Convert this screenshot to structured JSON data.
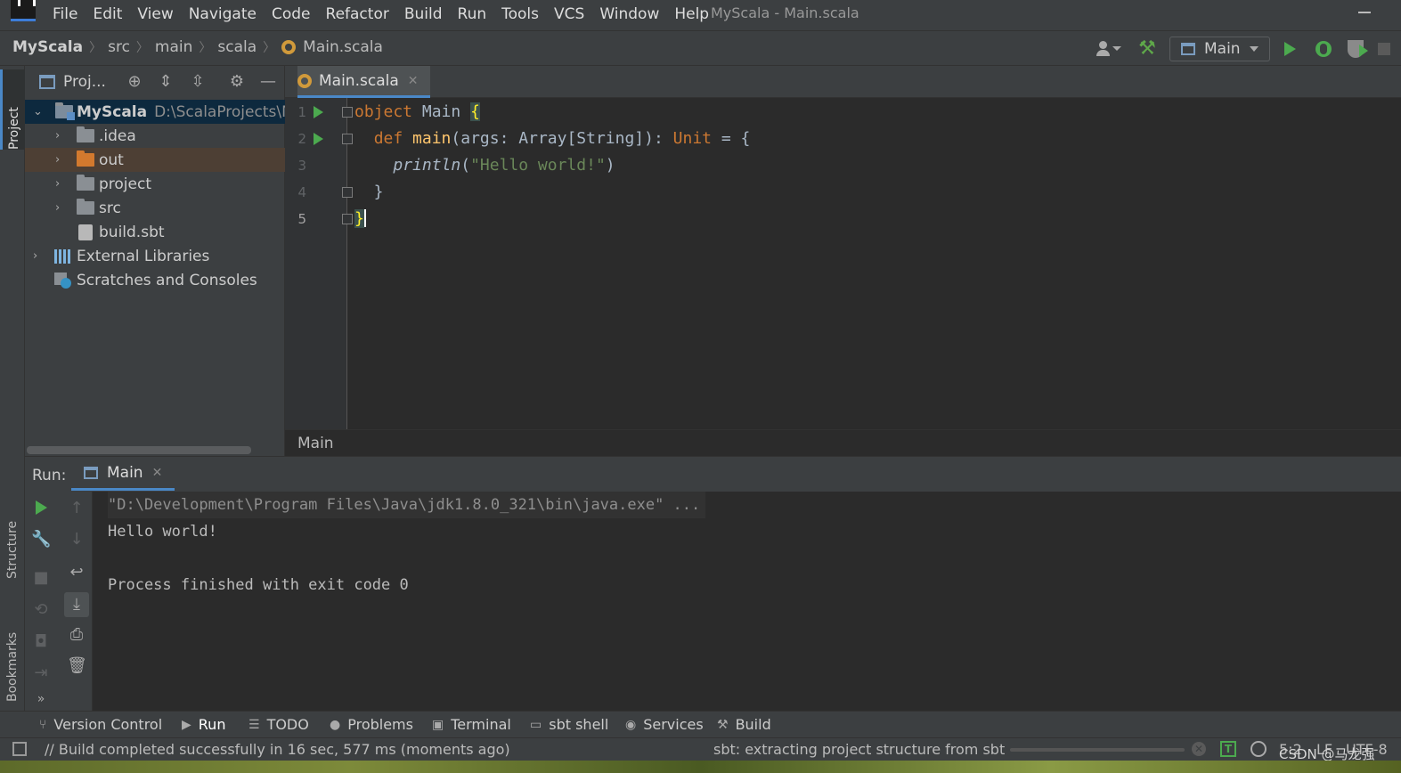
{
  "window": {
    "title": "MyScala - Main.scala"
  },
  "menu": {
    "items": [
      "File",
      "Edit",
      "View",
      "Navigate",
      "Code",
      "Refactor",
      "Build",
      "Run",
      "Tools",
      "VCS",
      "Window",
      "Help"
    ]
  },
  "breadcrumb": {
    "items": [
      "MyScala",
      "src",
      "main",
      "scala",
      "Main.scala"
    ]
  },
  "toolbar": {
    "run_config": "Main"
  },
  "side_tabs": {
    "project": "Project",
    "structure": "Structure",
    "bookmarks": "Bookmarks"
  },
  "project_panel": {
    "title": "Proj...",
    "tree": [
      {
        "label": "MyScala",
        "path": "D:\\ScalaProjects\\My"
      },
      {
        "label": ".idea"
      },
      {
        "label": "out"
      },
      {
        "label": "project"
      },
      {
        "label": "src"
      },
      {
        "label": "build.sbt"
      },
      {
        "label": "External Libraries"
      },
      {
        "label": "Scratches and Consoles"
      }
    ]
  },
  "editor": {
    "tab_label": "Main.scala",
    "line_numbers": [
      "1",
      "2",
      "3",
      "4",
      "5"
    ],
    "code": {
      "l1_kw": "object",
      "l1_name": " Main ",
      "l1_brace": "{",
      "l2_indent": "  ",
      "l2_kw": "def",
      "l2_sp": " ",
      "l2_fn": "main",
      "l2_args": "(args: Array[String]): ",
      "l2_type": "Unit",
      "l2_rest": " = {",
      "l3_indent": "    ",
      "l3_fn": "println",
      "l3_open": "(",
      "l3_str": "\"Hello world!\"",
      "l3_close": ")",
      "l4": "  }",
      "l5_brace": "}"
    },
    "breadcrumb": "Main"
  },
  "run_panel": {
    "title": "Run:",
    "tab_label": "Main",
    "console": [
      "\"D:\\Development\\Program Files\\Java\\jdk1.8.0_321\\bin\\java.exe\" ...",
      "Hello world!",
      "",
      "Process finished with exit code 0"
    ]
  },
  "bottom_tabs": [
    "Version Control",
    "Run",
    "TODO",
    "Problems",
    "Terminal",
    "sbt shell",
    "Services",
    "Build"
  ],
  "status_bar": {
    "message": "// Build completed successfully in 16 sec, 577 ms (moments ago)",
    "progress_text": "sbt: extracting project structure from sbt",
    "position": "5:2",
    "line_separator": "LF",
    "encoding": "UTF-8",
    "watermark": "CSDN @马龙强_"
  },
  "colors": {
    "keyword": "#cc7832",
    "function": "#ffc66d",
    "string": "#6a8759",
    "run_green": "#4caa4f",
    "accent_blue": "#4a88c7"
  }
}
